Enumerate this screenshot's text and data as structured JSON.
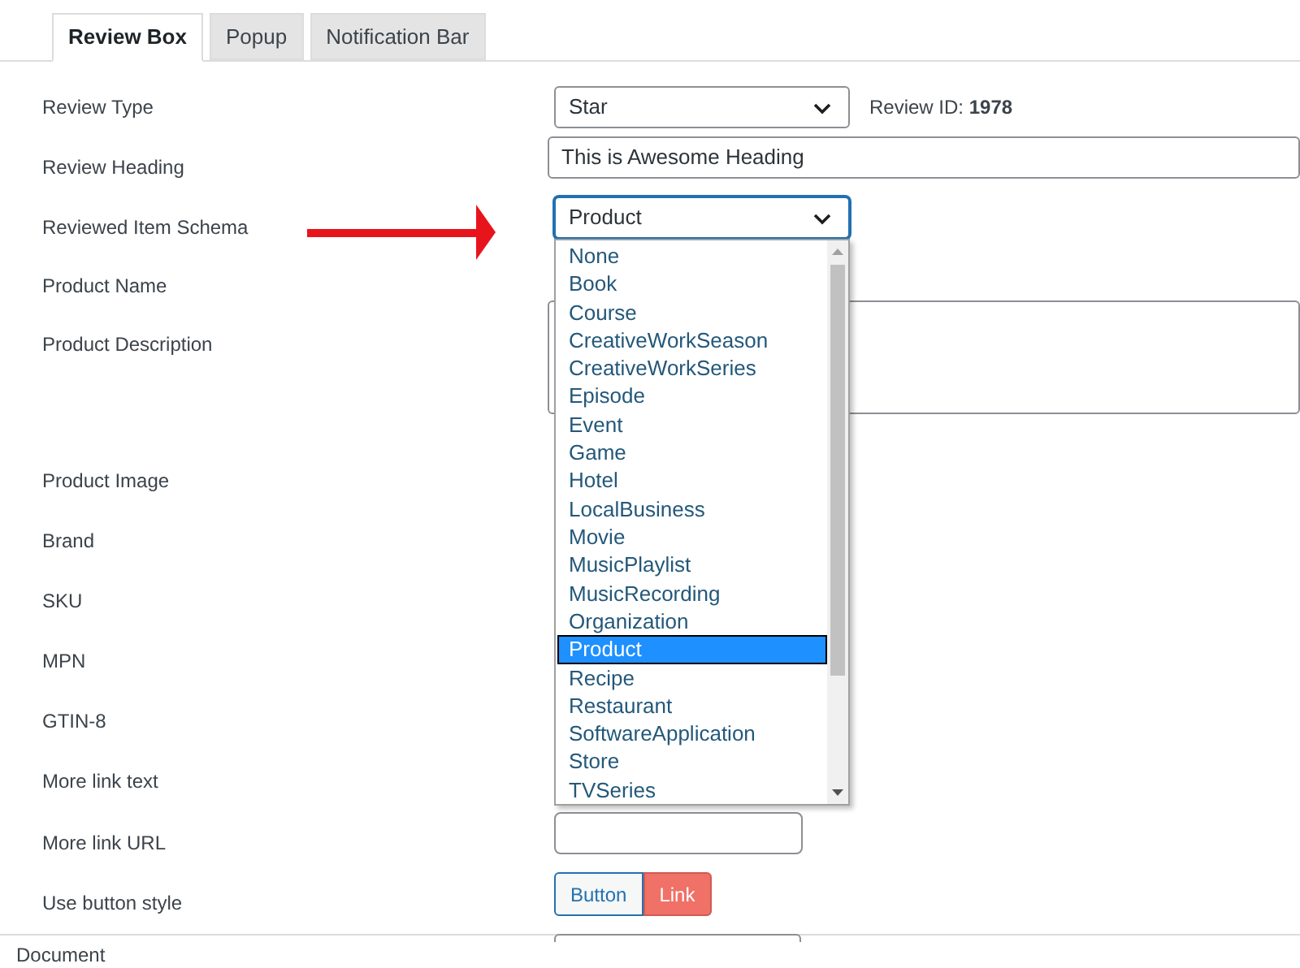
{
  "tabs": [
    {
      "label": "Review Box",
      "selected": true
    },
    {
      "label": "Popup",
      "selected": false
    },
    {
      "label": "Notification Bar",
      "selected": false
    }
  ],
  "fields": [
    {
      "label": "Review Type",
      "kind": "select",
      "value": "Star",
      "note": {
        "label": "Review ID:",
        "value": "1978"
      }
    },
    {
      "label": "Review Heading",
      "kind": "text",
      "value": "This is Awesome Heading"
    },
    {
      "label": "Reviewed Item Schema",
      "kind": "open-select",
      "value": "Product"
    },
    {
      "label": "Product Name",
      "kind": "hidden"
    },
    {
      "label": "Product Description",
      "kind": "textarea"
    },
    {
      "label": "Product Image",
      "kind": "hidden"
    },
    {
      "label": "Brand",
      "kind": "hidden"
    },
    {
      "label": "SKU",
      "kind": "hidden"
    },
    {
      "label": "MPN",
      "kind": "hidden"
    },
    {
      "label": "GTIN-8",
      "kind": "hidden"
    },
    {
      "label": "More link text",
      "kind": "hidden"
    },
    {
      "label": "More link URL",
      "kind": "input"
    },
    {
      "label": "Use button style",
      "kind": "toggle",
      "options": [
        {
          "label": "Button",
          "selected": false
        },
        {
          "label": "Link",
          "selected": true
        }
      ]
    }
  ],
  "schema_options": [
    {
      "label": "None",
      "selected": false
    },
    {
      "label": "Book",
      "selected": false
    },
    {
      "label": "Course",
      "selected": false
    },
    {
      "label": "CreativeWorkSeason",
      "selected": false
    },
    {
      "label": "CreativeWorkSeries",
      "selected": false
    },
    {
      "label": "Episode",
      "selected": false
    },
    {
      "label": "Event",
      "selected": false
    },
    {
      "label": "Game",
      "selected": false
    },
    {
      "label": "Hotel",
      "selected": false
    },
    {
      "label": "LocalBusiness",
      "selected": false
    },
    {
      "label": "Movie",
      "selected": false
    },
    {
      "label": "MusicPlaylist",
      "selected": false
    },
    {
      "label": "MusicRecording",
      "selected": false
    },
    {
      "label": "Organization",
      "selected": false
    },
    {
      "label": "Product",
      "selected": true
    },
    {
      "label": "Recipe",
      "selected": false
    },
    {
      "label": "Restaurant",
      "selected": false
    },
    {
      "label": "SoftwareApplication",
      "selected": false
    },
    {
      "label": "Store",
      "selected": false
    },
    {
      "label": "TVSeries",
      "selected": false
    }
  ],
  "footer": {
    "label": "Document"
  }
}
